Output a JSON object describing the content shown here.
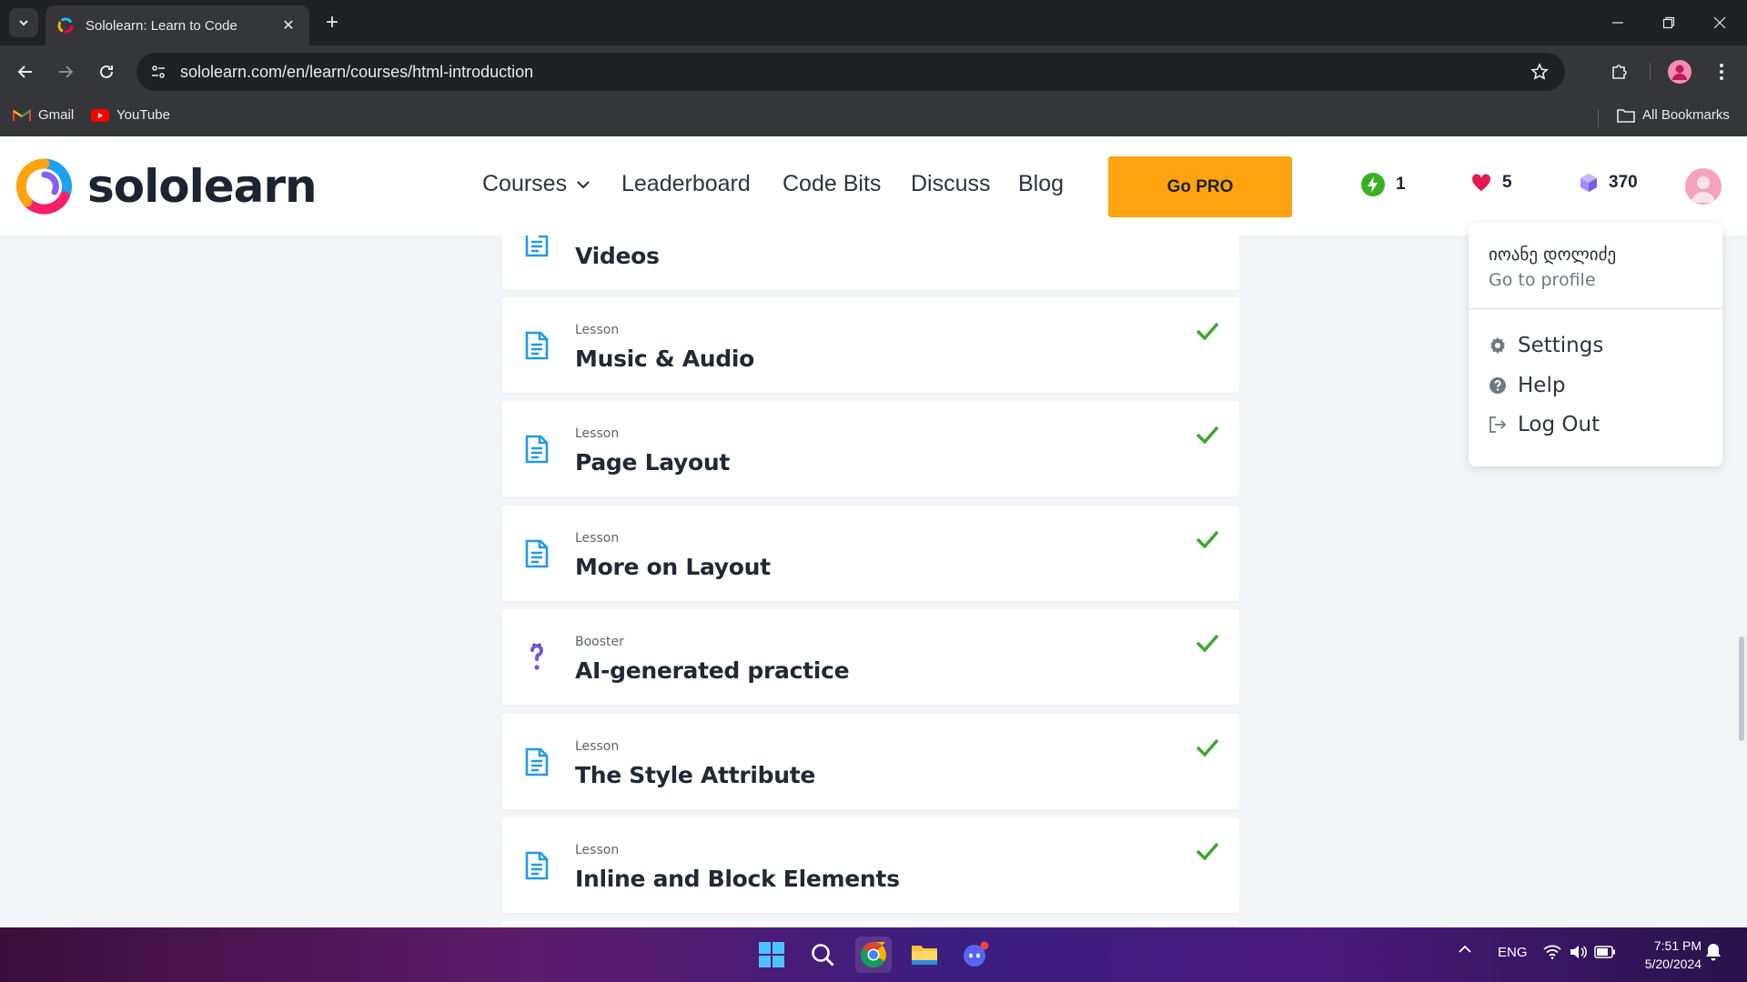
{
  "browser": {
    "tab_title": "Sololearn: Learn to Code",
    "url": "sololearn.com/en/learn/courses/html-introduction",
    "bookmarks": [
      {
        "label": "Gmail",
        "icon": "gmail-icon"
      },
      {
        "label": "YouTube",
        "icon": "youtube-icon"
      }
    ],
    "all_bookmarks_label": "All Bookmarks"
  },
  "header": {
    "logo_text": "sololearn",
    "nav": {
      "courses": "Courses",
      "leaderboard": "Leaderboard",
      "code_bits": "Code Bits",
      "discuss": "Discuss",
      "blog": "Blog"
    },
    "go_pro": "Go PRO",
    "stats": {
      "streak": "1",
      "hearts": "5",
      "bits": "370"
    },
    "colors": {
      "accent": "#ffa310",
      "streak": "#3bb01e",
      "heart": "#e5194d",
      "bits": "#8a6de9",
      "lesson_icon": "#1e9be8",
      "check": "#3aa82e"
    }
  },
  "lessons": [
    {
      "type": "",
      "title": "Videos",
      "icon": "lesson-doc-icon",
      "done": false
    },
    {
      "type": "Lesson",
      "title": "Music & Audio",
      "icon": "lesson-doc-icon",
      "done": true
    },
    {
      "type": "Lesson",
      "title": "Page Layout",
      "icon": "lesson-doc-icon",
      "done": true
    },
    {
      "type": "Lesson",
      "title": "More on Layout",
      "icon": "lesson-doc-icon",
      "done": true
    },
    {
      "type": "Booster",
      "title": "AI-generated practice",
      "icon": "question-booster-icon",
      "done": true
    },
    {
      "type": "Lesson",
      "title": "The Style Attribute",
      "icon": "lesson-doc-icon",
      "done": true
    },
    {
      "type": "Lesson",
      "title": "Inline and Block Elements",
      "icon": "lesson-doc-icon",
      "done": true
    }
  ],
  "profile_menu": {
    "user_name": "იოანე დოლიძე",
    "go_to_profile": "Go to profile",
    "items": [
      {
        "label": "Settings",
        "icon": "gear-icon"
      },
      {
        "label": "Help",
        "icon": "help-icon"
      },
      {
        "label": "Log Out",
        "icon": "logout-icon"
      }
    ]
  },
  "taskbar": {
    "language": "ENG",
    "time": "7:51 PM",
    "date": "5/20/2024"
  }
}
